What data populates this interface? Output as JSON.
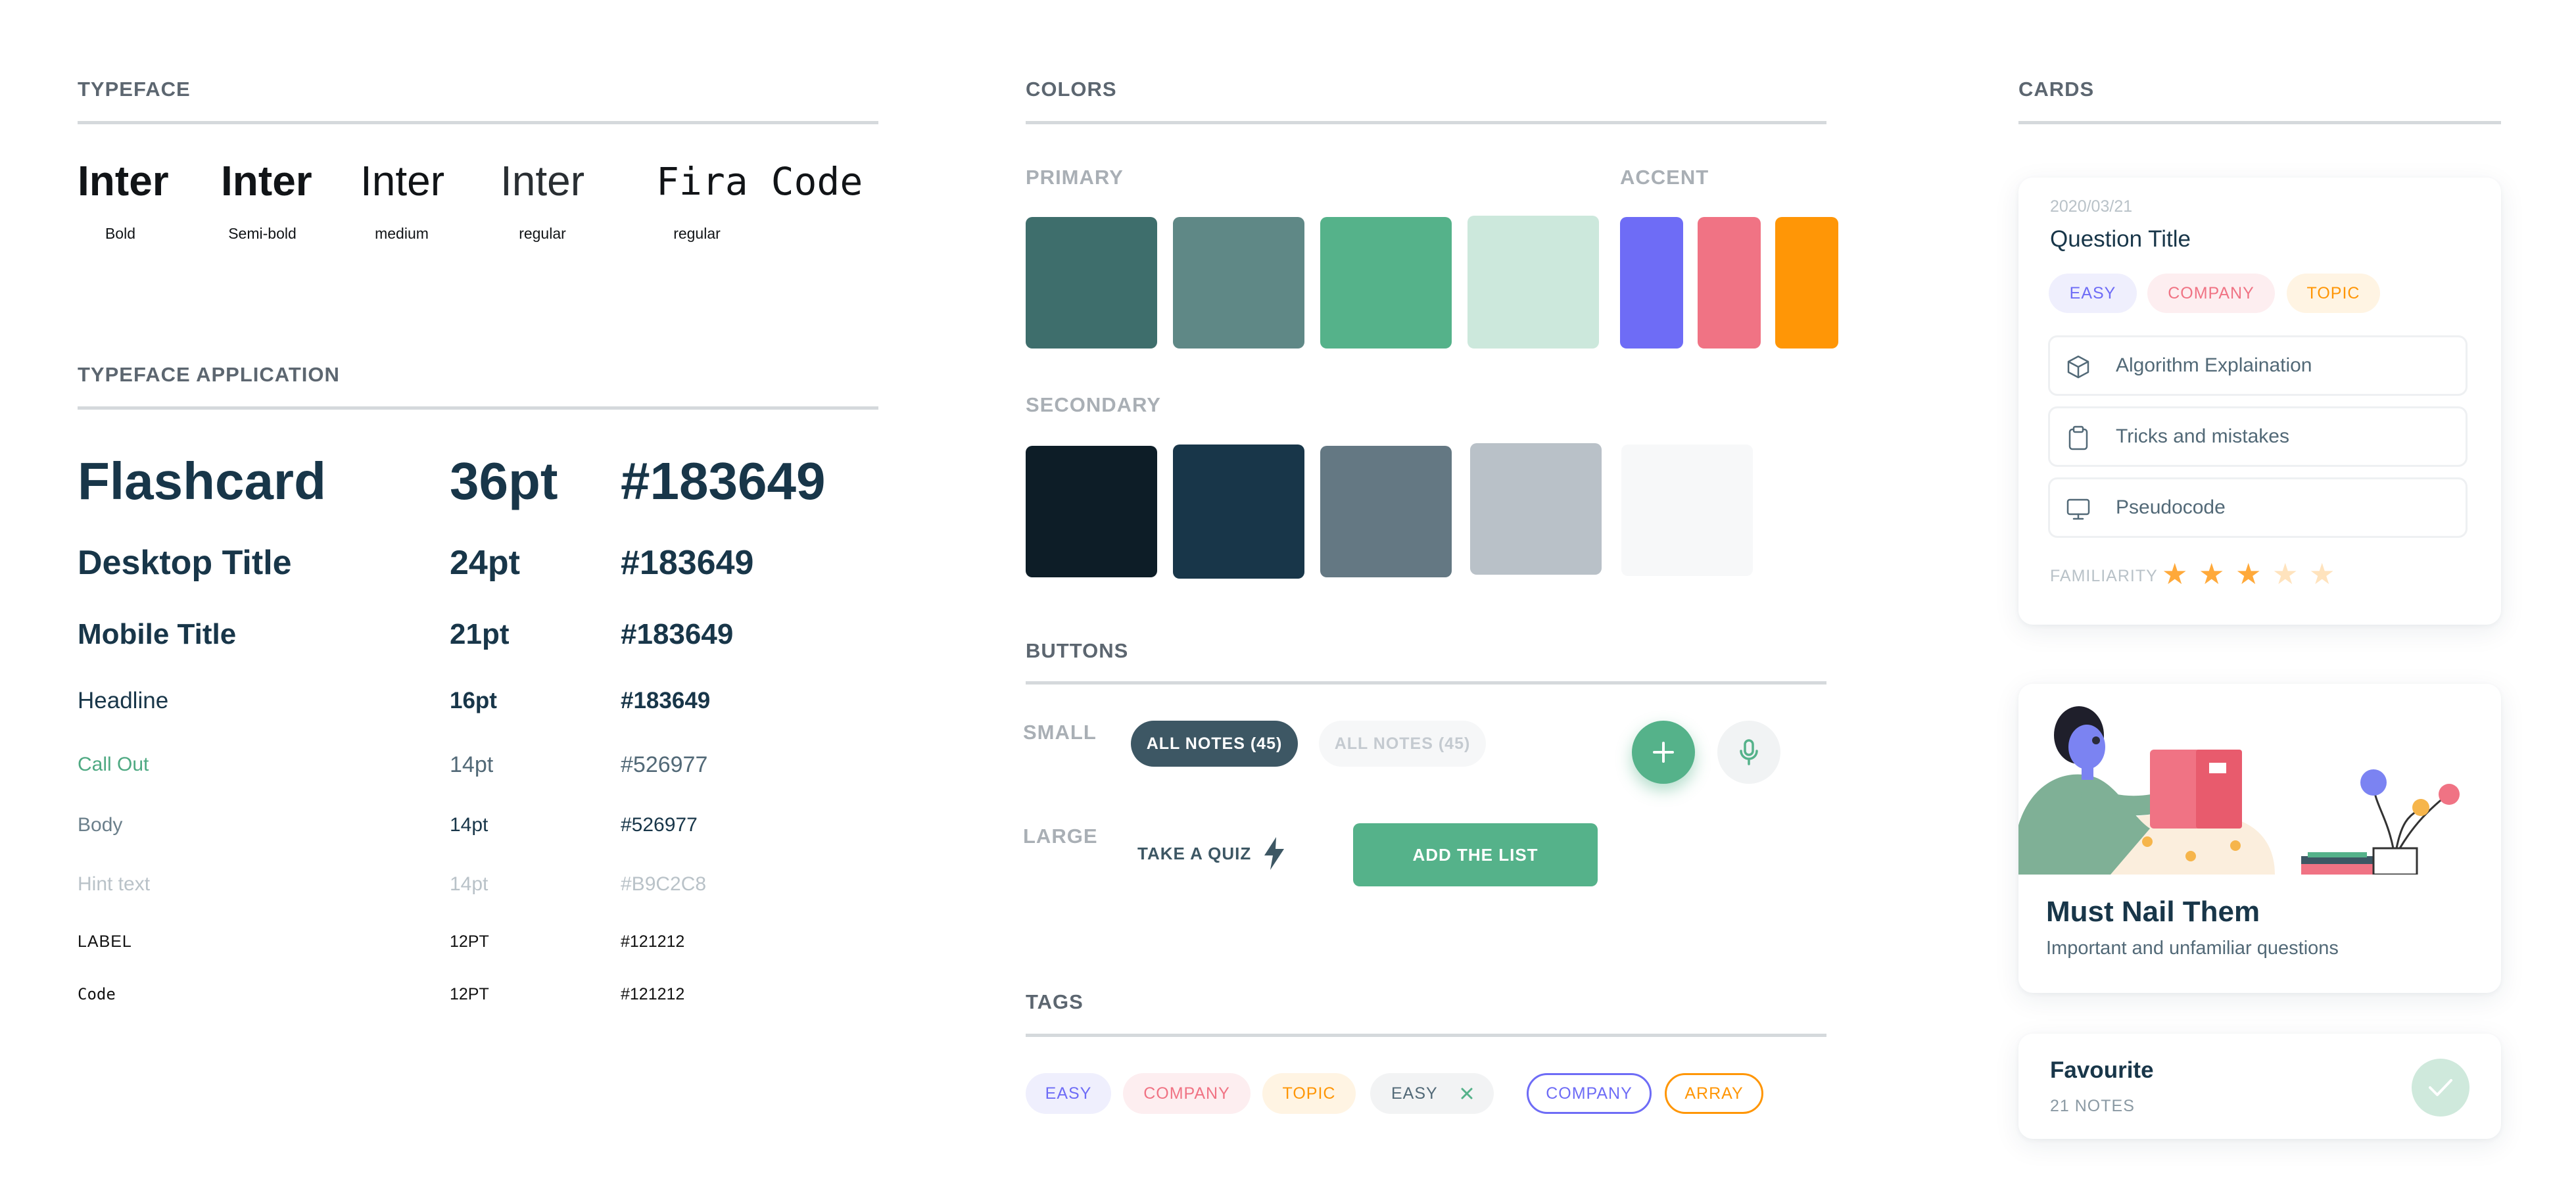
{
  "sections": {
    "typeface": "TYPEFACE",
    "application": "TYPEFACE APPLICATION",
    "colors": "COLORS",
    "buttons": "BUTTONS",
    "tags": "TAGS",
    "cards": "CARDS"
  },
  "typeface": {
    "samples": [
      {
        "name": "Inter",
        "weight": "Bold"
      },
      {
        "name": "Inter",
        "weight": "Semi-bold"
      },
      {
        "name": "Inter",
        "weight": "medium"
      },
      {
        "name": "Inter",
        "weight": "regular"
      },
      {
        "name": "Fira Code",
        "weight": "regular"
      }
    ]
  },
  "application": [
    {
      "name": "Flashcard",
      "size": "36pt",
      "color": "#183649"
    },
    {
      "name": "Desktop Title",
      "size": "24pt",
      "color": "#183649"
    },
    {
      "name": "Mobile Title",
      "size": "21pt",
      "color": "#183649"
    },
    {
      "name": "Headline",
      "size": "16pt",
      "color": "#183649"
    },
    {
      "name": "Call Out",
      "size": "14pt",
      "color": "#526977"
    },
    {
      "name": "Body",
      "size": "14pt",
      "color": "#526977"
    },
    {
      "name": "Hint text",
      "size": "14pt",
      "color": "#B9C2C8"
    },
    {
      "name": "LABEL",
      "size": "12PT",
      "color": "#121212"
    },
    {
      "name": "Code",
      "size": "12PT",
      "color": "#121212"
    }
  ],
  "colors": {
    "primary_label": "PRIMARY",
    "accent_label": "ACCENT",
    "secondary_label": "SECONDARY",
    "primary": [
      "#3E6E6C",
      "#5F8886",
      "#55B28A",
      "#CCE8DC"
    ],
    "accent": [
      "#6E6CF6",
      "#F07384",
      "#FF9606"
    ],
    "secondary": [
      "#0D1D27",
      "#183649",
      "#647883",
      "#B9C1C8",
      "#F7F8F9"
    ]
  },
  "buttons": {
    "small_label": "SMALL",
    "large_label": "LARGE",
    "all_notes_active": "ALL NOTES (45)",
    "all_notes_inactive": "ALL NOTES (45)",
    "take_quiz": "TAKE A QUIZ",
    "add_list": "ADD THE LIST",
    "add_icon": "plus-icon",
    "mic_icon": "microphone-icon"
  },
  "tags": {
    "easy": "EASY",
    "company": "COMPANY",
    "topic": "TOPIC",
    "easy_removable": "EASY",
    "company_outline": "COMPANY",
    "array_outline": "ARRAY"
  },
  "card_question": {
    "date": "2020/03/21",
    "title": "Question Title",
    "tags": [
      "EASY",
      "COMPANY",
      "TOPIC"
    ],
    "rows": [
      {
        "icon": "cube-icon",
        "label": "Algorithm Explaination"
      },
      {
        "icon": "clipboard-icon",
        "label": "Tricks and mistakes"
      },
      {
        "icon": "monitor-icon",
        "label": "Pseudocode"
      }
    ],
    "familiarity_label": "FAMILIARITY",
    "familiarity_rating": 3,
    "familiarity_max": 5
  },
  "card_illustration": {
    "title": "Must Nail Them",
    "subtitle": "Important and unfamiliar questions"
  },
  "card_favourite": {
    "title": "Favourite",
    "count": "21 NOTES"
  },
  "palette": {
    "text_dark": "#183649",
    "text_body": "#526977",
    "green": "#55B28A"
  }
}
